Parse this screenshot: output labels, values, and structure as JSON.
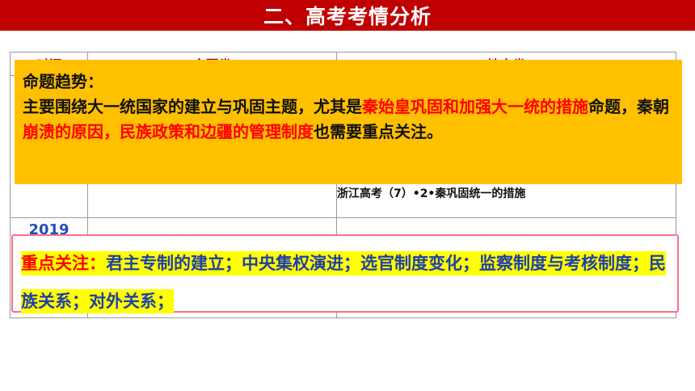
{
  "header": {
    "title": "二、高考考情分析"
  },
  "table": {
    "headers": [
      "时间",
      "全国卷",
      "地方卷"
    ],
    "rows": [
      {
        "year": "",
        "national": "",
        "local": "浙江高考（7）•2•秦巩固统一的措施"
      },
      {
        "year": "2019",
        "national": "",
        "local": ""
      }
    ]
  },
  "trend": {
    "label": "命题趋势：",
    "segments": [
      {
        "text": "主要围绕大一统国家的建立与巩固主题，尤其是",
        "color": "#111111"
      },
      {
        "text": "秦始皇巩固和加强大一统的措施",
        "color": "#ff0000"
      },
      {
        "text": "命题，秦朝",
        "color": "#111111"
      },
      {
        "text": "崩溃的原因，民族政策和边疆的管理制度",
        "color": "#ff0000"
      },
      {
        "text": "也需要重点关注。",
        "color": "#111111"
      }
    ]
  },
  "focus": {
    "label": "重点关注：",
    "content": "君主专制的建立；中央集权演进；选官制度变化；监察制度与考核制度；民族关系；对外关系；"
  },
  "colors": {
    "title_bg": "#c00000",
    "trend_bg": "#ffc000",
    "highlight": "#ffff00",
    "accent_red": "#ff0000",
    "focus_text": "#1f3fa8",
    "year_blue": "#1f4fbf"
  }
}
